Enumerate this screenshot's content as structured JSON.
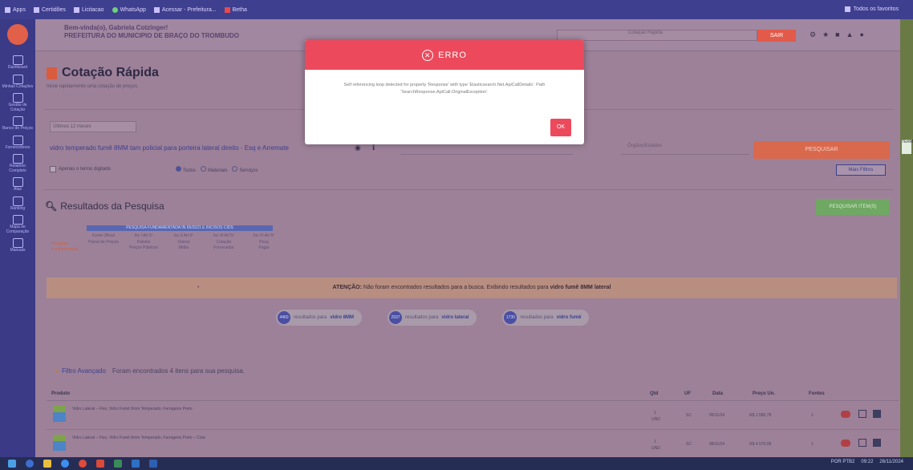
{
  "bookmarks": {
    "items": [
      "Apps",
      "Certidões",
      "Licitacao",
      "WhatsApp",
      "Acessar - Prefeitura...",
      "Betha"
    ],
    "right": "Todos os favoritos"
  },
  "sidebar": {
    "items": [
      "Dashboard",
      "Minhas Cotações",
      "Gestão de Cotação",
      "Banco de Preços",
      "Fornecedores",
      "Relatório Completo",
      "Atas",
      "Ranking",
      "Mapa de Comparação",
      "Manuais"
    ]
  },
  "header": {
    "welcome": "Bem-vinda(o), Gabriela Cotzinger!",
    "org": "PREFEITURA DO MUNICIPIO DE BRAÇO DO TROMBUDO",
    "quick_search": "Cotação Rápida",
    "sair": "SAIR"
  },
  "page": {
    "title": "Cotação Rápida",
    "subtitle": "Inicie rapidamente uma cotação de preços."
  },
  "search": {
    "period": "Últimos 12 meses",
    "term": "vidro temperado fumê 8MM tam policial para porteira lateral direito - Esq e Arremate",
    "orgs_placeholder": "Órgãos/Estados",
    "button": "PESQUISAR"
  },
  "filters": {
    "checkbox_label": "Apenas o termo digitado",
    "radios": [
      "Todos",
      "Materiais",
      "Serviços"
    ],
    "more": "Mais Filtros"
  },
  "results": {
    "title": "Resultados da Pesquisa",
    "path_button": "PESQUISAR ITEM(S)"
  },
  "grid": {
    "header": "PESQUISA FUNDAMENTADA IN 65/2021 E INCISOS CIDS",
    "label": "Pesquisa Fundamentada",
    "cols": [
      [
        "Fonte Oficial",
        "Painel de Preços"
      ],
      [
        "Inc I Art 5º",
        "Painéis",
        "Preços Públicos"
      ],
      [
        "Inc II Art 5º",
        "Outros",
        "Mídia"
      ],
      [
        "Inc III Art 5º",
        "Cotação",
        "Fornecedor"
      ],
      [
        "Inc IV Art 5º",
        "Pesq",
        "Pagar"
      ]
    ]
  },
  "atencao": {
    "label": "ATENÇÃO:",
    "text": "Não foram encontrados resultados para a busca. Exibindo resultados para",
    "term": "vidro fumê 8MM lateral"
  },
  "counters": [
    {
      "n": "4460",
      "text": "resultados para",
      "term": "vidro 8MM"
    },
    {
      "n": "2937",
      "text": "resultados para",
      "term": "vidro lateral"
    },
    {
      "n": "1730",
      "text": "resultados para",
      "term": "vidro fumê"
    }
  ],
  "filtro": {
    "link": "Filtro Avançado",
    "text": "Foram encontrados 4 itens para sua pesquisa."
  },
  "table": {
    "headers": [
      "Produto",
      "Qtd",
      "UF",
      "Data",
      "Preço Un.",
      "Fontes"
    ],
    "rows": [
      {
        "desc": "Vidro Lateral – Fixo, Vidro Fumê 8mm Temperado, Ferragens Preto",
        "qty": "1",
        "unit": "UND",
        "uf": "SC",
        "date": "05/11/24",
        "price": "R$ 1.580,78",
        "fontes": "1"
      },
      {
        "desc": "Vidro Lateral – Fixo, Vidro Fumê 8mm Temperado, Ferragens Preto – Cota",
        "qty": "1",
        "unit": "UND",
        "uf": "SC",
        "date": "08/11/24",
        "price": "R$ 4.570,08",
        "fontes": "1"
      }
    ]
  },
  "modal": {
    "title": "ERRO",
    "message": "Self referencing loop detected for property 'Response' with type 'Elasticsearch.Net.ApiCallDetails'. Path 'SearchResponse.ApiCall.OriginalException'.",
    "ok": "OK"
  },
  "taskbar": {
    "time": "09:22",
    "date": "26/11/2024",
    "lang": "POR PTB2"
  },
  "right_strip": "TERMO"
}
